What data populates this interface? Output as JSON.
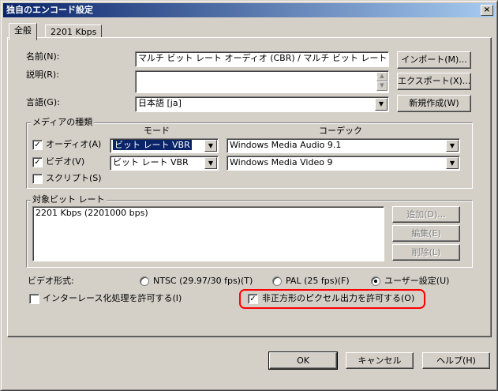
{
  "window": {
    "title": "独自のエンコード設定",
    "close_glyph": "×"
  },
  "tabs": [
    {
      "label": "全般"
    },
    {
      "label": "2201 Kbps"
    }
  ],
  "general": {
    "name_label": "名前(N):",
    "name_value": "マルチ ビット レート オーディオ (CBR) / マルチ ビット レート ビ",
    "description_label": "説明(R):",
    "description_value": "",
    "language_label": "言語(G):",
    "language_value": "日本語 [ja]",
    "import_button": "インポート(M)...",
    "export_button": "エクスポート(X)...",
    "new_button": "新規作成(W)"
  },
  "media_group": {
    "title": "メディアの種類",
    "mode_header": "モード",
    "codec_header": "コーデック",
    "rows": [
      {
        "label": "オーディオ(A)",
        "checked": true,
        "mode": "ビット レート VBR",
        "codec": "Windows Media Audio 9.1"
      },
      {
        "label": "ビデオ(V)",
        "checked": true,
        "mode": "ビット レート VBR",
        "codec": "Windows Media Video 9"
      },
      {
        "label": "スクリプト(S)",
        "checked": false
      }
    ]
  },
  "bitrate_group": {
    "title": "対象ビット レート",
    "items": [
      "2201 Kbps (2201000 bps)"
    ],
    "add_button": "追加(D)...",
    "edit_button": "編集(E)",
    "delete_button": "削除(L)"
  },
  "video_format": {
    "label": "ビデオ形式:",
    "options": [
      {
        "label": "NTSC (29.97/30 fps)(T)",
        "selected": false
      },
      {
        "label": "PAL (25 fps)(F)",
        "selected": false
      },
      {
        "label": "ユーザー設定(U)",
        "selected": true
      }
    ]
  },
  "options": {
    "interlace_label": "インターレース化処理を許可する(I)",
    "interlace_checked": false,
    "nonsquare_label": "非正方形のピクセル出力を許可する(O)",
    "nonsquare_checked": true
  },
  "footer": {
    "ok": "OK",
    "cancel": "キャンセル",
    "help": "ヘルプ(H)"
  },
  "colors": {
    "title_start": "#0a246a",
    "title_end": "#a6caf0",
    "face": "#d4d0c8",
    "highlight_ring": "#ff0000",
    "selection": "#0a246a"
  }
}
